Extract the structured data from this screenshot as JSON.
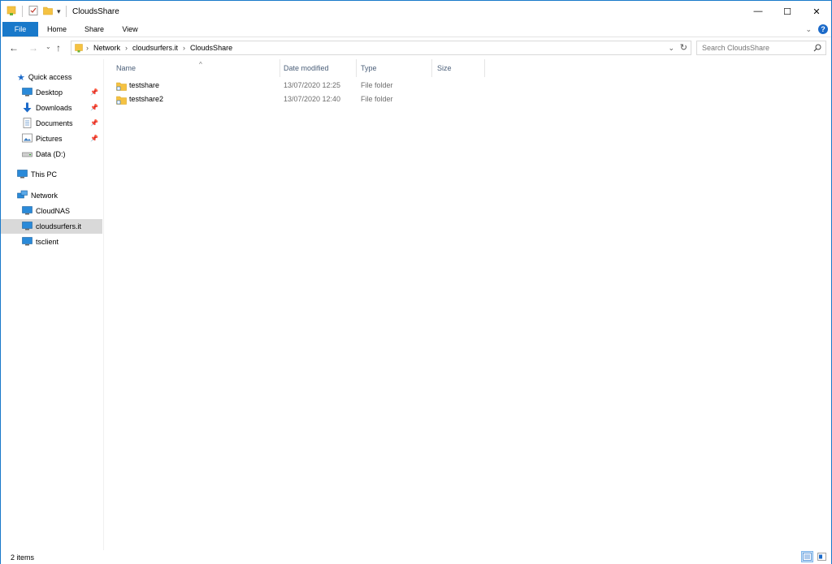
{
  "window": {
    "title": "CloudsShare",
    "controls": {
      "minimize": "—",
      "maximize": "☐",
      "close": "✕"
    }
  },
  "ribbon": {
    "tabs": [
      "File",
      "Home",
      "Share",
      "View"
    ],
    "collapse_icon": "chevron-down-icon",
    "help_label": "?"
  },
  "address": {
    "crumbs": [
      "Network",
      "cloudsurfers.it",
      "CloudsShare"
    ],
    "search_placeholder": "Search CloudsShare"
  },
  "navpane": {
    "quick_access": "Quick access",
    "quick_items": [
      {
        "label": "Desktop",
        "pinned": true
      },
      {
        "label": "Downloads",
        "pinned": true
      },
      {
        "label": "Documents",
        "pinned": true
      },
      {
        "label": "Pictures",
        "pinned": true
      },
      {
        "label": "Data (D:)",
        "pinned": false
      }
    ],
    "this_pc": "This PC",
    "network": "Network",
    "network_items": [
      "CloudNAS",
      "cloudsurfers.it",
      "tsclient"
    ],
    "selected": "cloudsurfers.it"
  },
  "columns": {
    "name": "Name",
    "date": "Date modified",
    "type": "Type",
    "size": "Size"
  },
  "files": [
    {
      "name": "testshare",
      "date": "13/07/2020 12:25",
      "type": "File folder",
      "size": ""
    },
    {
      "name": "testshare2",
      "date": "13/07/2020 12:40",
      "type": "File folder",
      "size": ""
    }
  ],
  "status": {
    "count": "2 items"
  },
  "colors": {
    "accent": "#1979ca",
    "selected_bg": "#d9d9d9",
    "folder": "#f5c242"
  }
}
